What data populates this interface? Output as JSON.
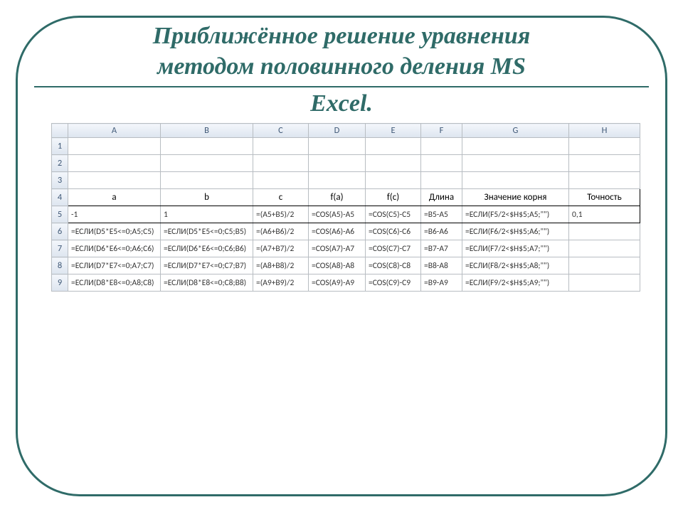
{
  "title": {
    "line1": "Приближённое решение уравнения",
    "line2": "методом половинного деления  MS",
    "line3": "Excel."
  },
  "sheet": {
    "columns": [
      "A",
      "B",
      "C",
      "D",
      "E",
      "F",
      "G",
      "H"
    ],
    "row_numbers": [
      "1",
      "2",
      "3",
      "4",
      "5",
      "6",
      "7",
      "8",
      "9"
    ],
    "rows": [
      {
        "n": "1",
        "class": "blank",
        "cells": [
          "",
          "",
          "",
          "",
          "",
          "",
          "",
          ""
        ]
      },
      {
        "n": "2",
        "class": "blank",
        "cells": [
          "",
          "",
          "",
          "",
          "",
          "",
          "",
          ""
        ]
      },
      {
        "n": "3",
        "class": "blank",
        "cells": [
          "",
          "",
          "",
          "",
          "",
          "",
          "",
          ""
        ]
      },
      {
        "n": "4",
        "class": "labels",
        "cells": [
          "a",
          "b",
          "c",
          "f(a)",
          "f(c)",
          "Длина",
          "Значение корня",
          "Точность"
        ]
      },
      {
        "n": "5",
        "class": "row5 formula",
        "cells": [
          "-1",
          "1",
          "=(A5+B5)/2",
          "=COS(A5)-A5",
          "=COS(C5)-C5",
          "=B5-A5",
          "=ЕСЛИ(F5/2<$H$5;A5;\"\")",
          "0,1"
        ]
      },
      {
        "n": "6",
        "class": "formula",
        "cells": [
          "=ЕСЛИ(D5*E5<=0;A5;C5)",
          "=ЕСЛИ(D5*E5<=0;C5;B5)",
          "=(A6+B6)/2",
          "=COS(A6)-A6",
          "=COS(C6)-C6",
          "=B6-A6",
          "=ЕСЛИ(F6/2<$H$5;A6;\"\")",
          ""
        ]
      },
      {
        "n": "7",
        "class": "formula",
        "cells": [
          "=ЕСЛИ(D6*E6<=0;A6;C6)",
          "=ЕСЛИ(D6*E6<=0;C6;B6)",
          "=(A7+B7)/2",
          "=COS(A7)-A7",
          "=COS(C7)-C7",
          "=B7-A7",
          "=ЕСЛИ(F7/2<$H$5;A7;\"\")",
          ""
        ]
      },
      {
        "n": "8",
        "class": "formula",
        "cells": [
          "=ЕСЛИ(D7*E7<=0;A7;C7)",
          "=ЕСЛИ(D7*E7<=0;C7;B7)",
          "=(A8+B8)/2",
          "=COS(A8)-A8",
          "=COS(C8)-C8",
          "=B8-A8",
          "=ЕСЛИ(F8/2<$H$5;A8;\"\")",
          ""
        ]
      },
      {
        "n": "9",
        "class": "formula",
        "cells": [
          "=ЕСЛИ(D8*E8<=0;A8;C8)",
          "=ЕСЛИ(D8*E8<=0;C8;B8)",
          "=(A9+B9)/2",
          "=COS(A9)-A9",
          "=COS(C9)-C9",
          "=B9-A9",
          "=ЕСЛИ(F9/2<$H$5;A9;\"\")",
          ""
        ]
      }
    ]
  }
}
